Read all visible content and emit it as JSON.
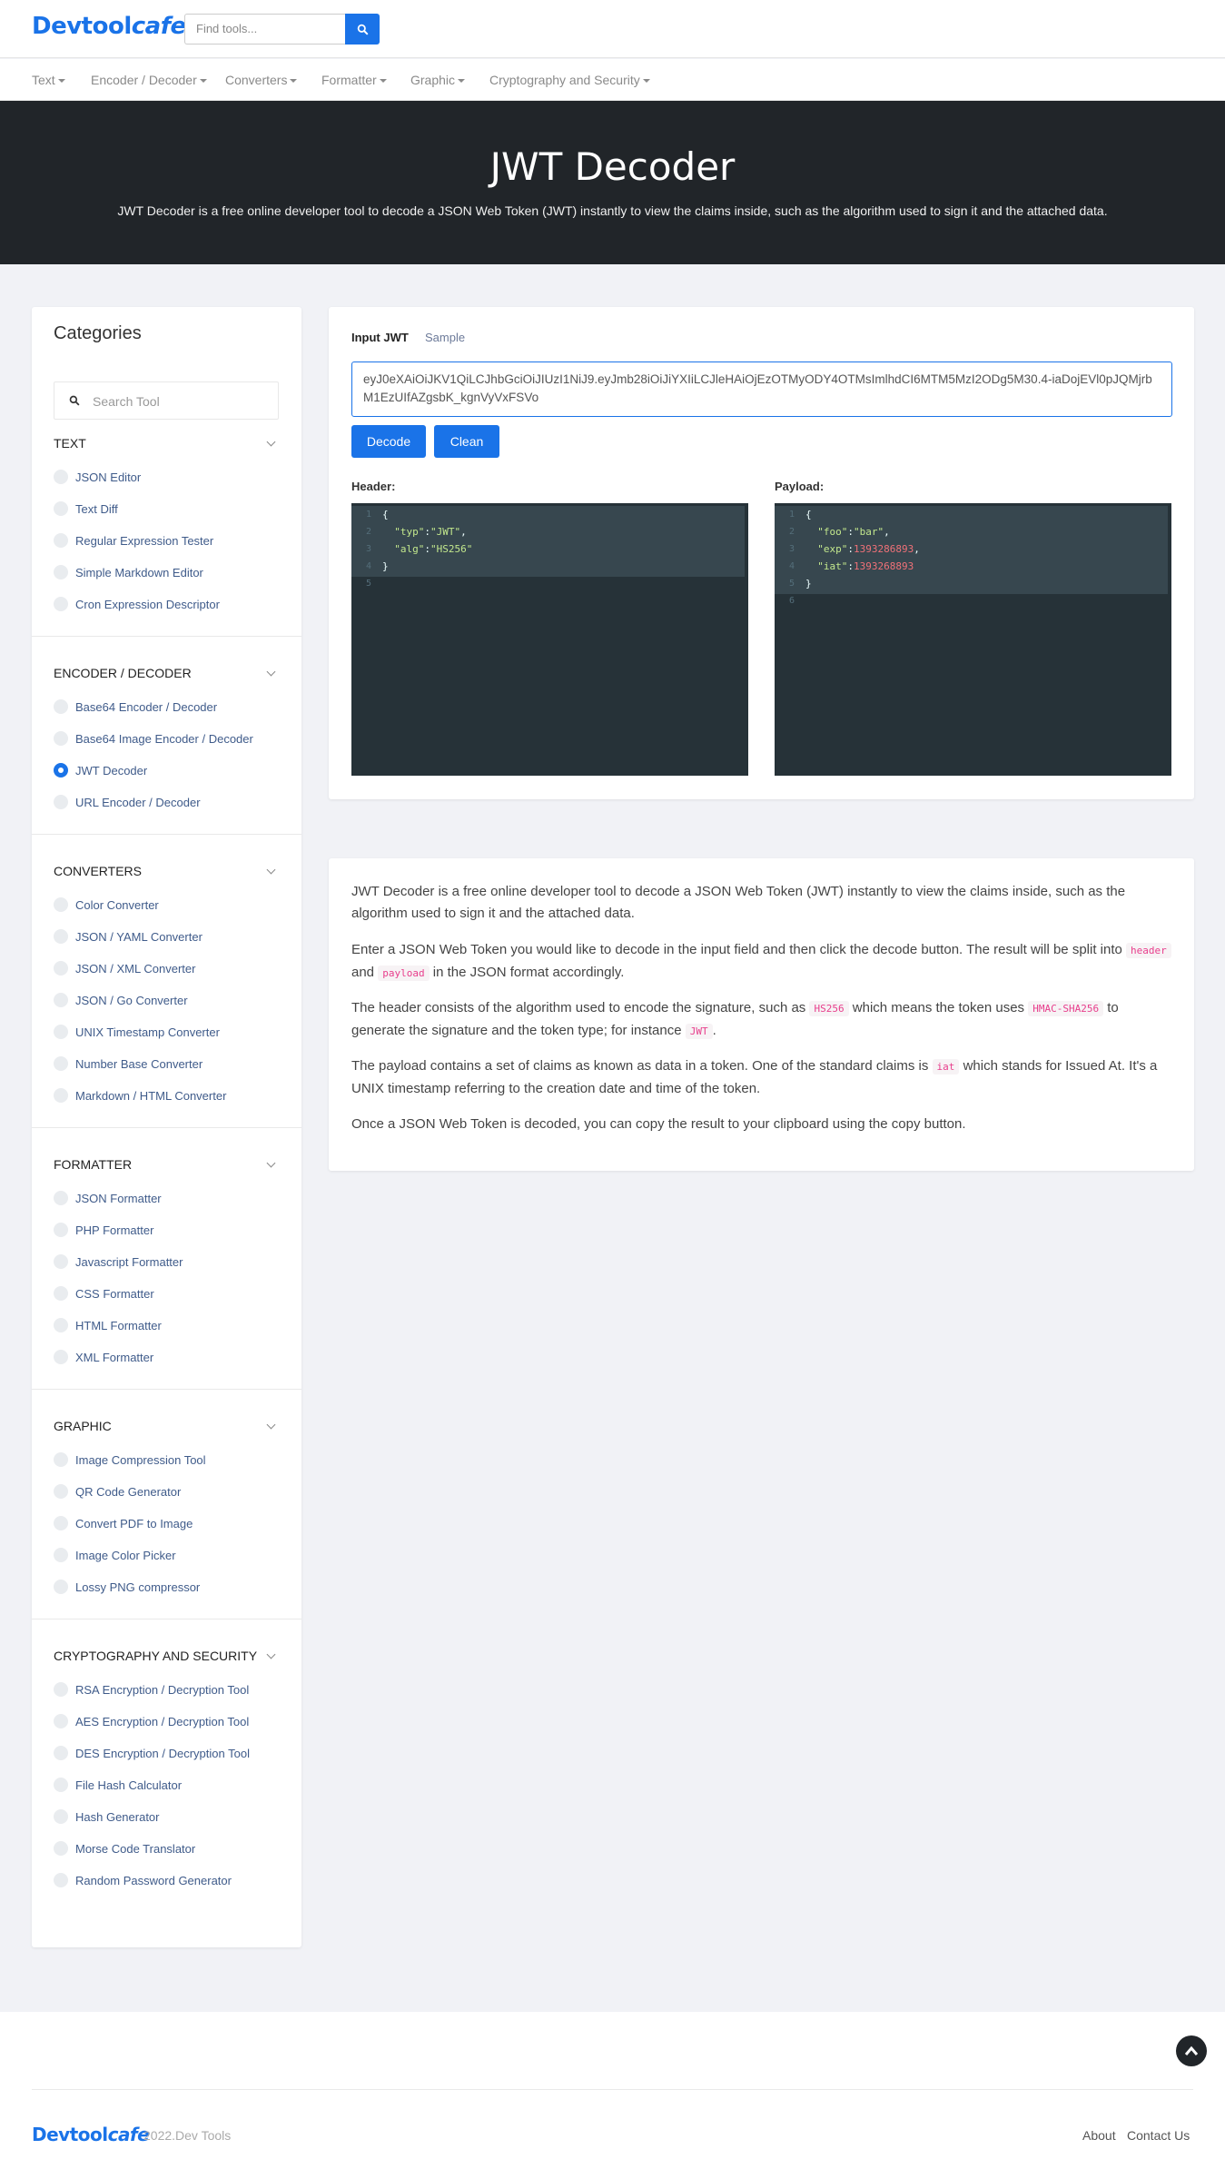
{
  "header": {
    "logo_main": "Devtool",
    "logo_cafe": "cafe",
    "search_placeholder": "Find tools..."
  },
  "nav": [
    {
      "label": "Text"
    },
    {
      "label": "Encoder / Decoder"
    },
    {
      "label": "Converters"
    },
    {
      "label": "Formatter"
    },
    {
      "label": "Graphic"
    },
    {
      "label": "Cryptography and Security"
    }
  ],
  "hero": {
    "title": "JWT Decoder",
    "subtitle": "JWT Decoder is a free online developer tool to decode a JSON Web Token (JWT) instantly to view the claims inside, such as the algorithm used to sign it and the attached data."
  },
  "sidebar": {
    "title": "Categories",
    "search_placeholder": "Search Tool",
    "categories": [
      {
        "title": "TEXT",
        "items": [
          "JSON Editor",
          "Text Diff",
          "Regular Expression Tester",
          "Simple Markdown Editor",
          "Cron Expression Descriptor"
        ]
      },
      {
        "title": "ENCODER / DECODER",
        "items": [
          "Base64 Encoder / Decoder",
          "Base64 Image Encoder / Decoder",
          "JWT Decoder",
          "URL Encoder / Decoder"
        ]
      },
      {
        "title": "CONVERTERS",
        "items": [
          "Color Converter",
          "JSON / YAML Converter",
          "JSON / XML Converter",
          "JSON / Go Converter",
          "UNIX Timestamp Converter",
          "Number Base Converter",
          "Markdown / HTML Converter"
        ]
      },
      {
        "title": "FORMATTER",
        "items": [
          "JSON Formatter",
          "PHP Formatter",
          "Javascript Formatter",
          "CSS Formatter",
          "HTML Formatter",
          "XML Formatter"
        ]
      },
      {
        "title": "GRAPHIC",
        "items": [
          "Image Compression Tool",
          "QR Code Generator",
          "Convert PDF to Image",
          "Image Color Picker",
          "Lossy PNG compressor"
        ]
      },
      {
        "title": "CRYPTOGRAPHY AND SECURITY",
        "items": [
          "RSA Encryption / Decryption Tool",
          "AES Encryption / Decryption Tool",
          "DES Encryption / Decryption Tool",
          "File Hash Calculator",
          "Hash Generator",
          "Morse Code Translator",
          "Random Password Generator"
        ]
      }
    ],
    "selected": "JWT Decoder"
  },
  "tool": {
    "tab_input": "Input JWT",
    "tab_sample": "Sample",
    "jwt_value": "eyJ0eXAiOiJKV1QiLCJhbGciOiJIUzI1NiJ9.eyJmb28iOiJiYXIiLCJleHAiOjEzOTMyODY4OTMsImlhdCI6MTM5MzI2ODg5M30.4-iaDojEVl0pJQMjrbM1EzUIfAZgsbK_kgnVyVxFSVo",
    "decode_label": "Decode",
    "clean_label": "Clean",
    "header_label": "Header:",
    "payload_label": "Payload:",
    "header_json": {
      "typ": "JWT",
      "alg": "HS256"
    },
    "payload_json": {
      "foo": "bar",
      "exp": 1393286893,
      "iat": 1393268893
    },
    "header_lines": [
      "{",
      "  \"typ\":\"JWT\",",
      "  \"alg\":\"HS256\"",
      "}",
      ""
    ],
    "payload_lines": [
      "{",
      "  \"foo\":\"bar\",",
      "  \"exp\":1393286893,",
      "  \"iat\":1393268893",
      "}",
      ""
    ]
  },
  "description": {
    "p1": "JWT Decoder is a free online developer tool to decode a JSON Web Token (JWT) instantly to view the claims inside, such as the algorithm used to sign it and the attached data.",
    "p2_a": "Enter a JSON Web Token you would like to decode in the input field and then click the decode button. The result will be split into",
    "p2_code1": "header",
    "p2_b": "and",
    "p2_code2": "payload",
    "p2_c": "in the JSON format accordingly.",
    "p3_a": "The header consists of the algorithm used to encode the signature, such as",
    "p3_code1": "HS256",
    "p3_b": "which means the token uses",
    "p3_code2": "HMAC-SHA256",
    "p3_c": "to generate the signature and the token type; for instance",
    "p3_code3": "JWT",
    "p3_d": ".",
    "p4_a": "The payload contains a set of claims as known as data in a token. One of the standard claims is",
    "p4_code1": "iat",
    "p4_b": "which stands for Issued At. It's a UNIX timestamp referring to the creation date and time of the token.",
    "p5": "Once a JSON Web Token is decoded, you can copy the result to your clipboard using the copy button."
  },
  "footer": {
    "logo_main": "Devtool",
    "logo_cafe": "cafe",
    "copyright": "2022.Dev Tools",
    "about": "About",
    "contact": "Contact Us"
  },
  "colors": {
    "accent": "#1a73e8",
    "hero_bg": "#212529",
    "editor_bg": "#263238"
  }
}
